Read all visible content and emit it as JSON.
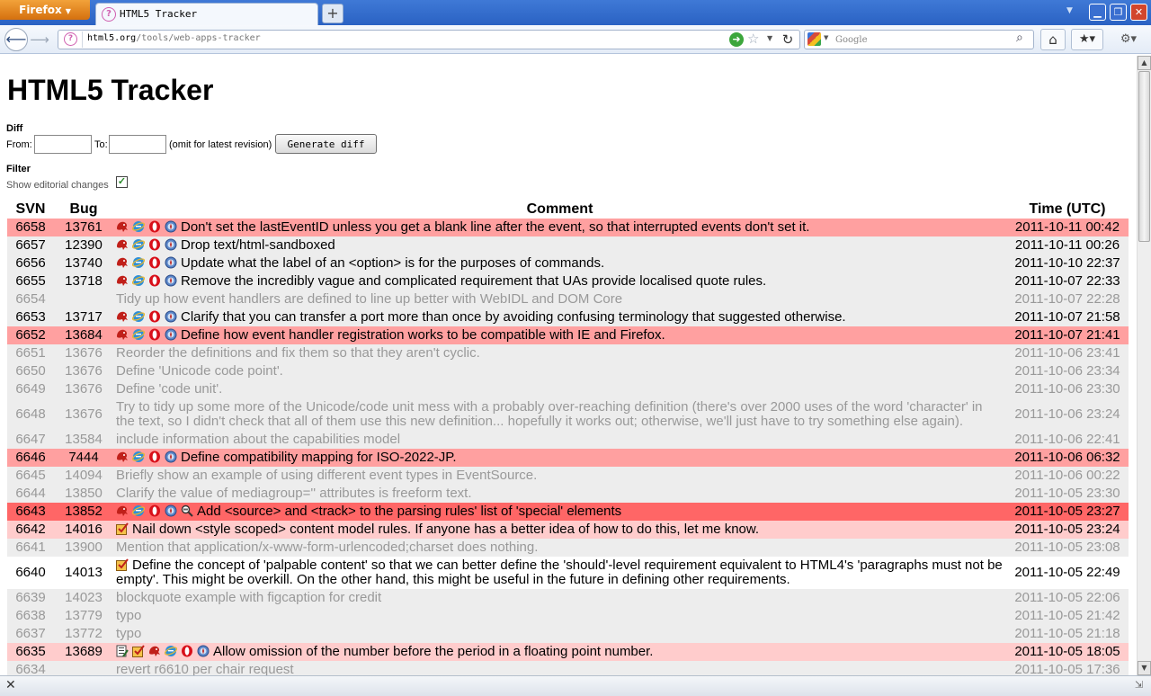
{
  "browser": {
    "app_button": "Firefox",
    "tab_title": "HTML5 Tracker",
    "new_tab": "+",
    "url_host": "html5.org",
    "url_path": "/tools/web-apps-tracker",
    "search_placeholder": "Google"
  },
  "page": {
    "title": "HTML5 Tracker",
    "diff": {
      "heading": "Diff",
      "from_label": "From:",
      "to_label": "To:",
      "omit_note": "(omit for latest revision)",
      "button": "Generate diff"
    },
    "filter": {
      "heading": "Filter",
      "editorial_label": "Show editorial changes",
      "editorial_checked": true
    },
    "table": {
      "headers": {
        "svn": "SVN",
        "bug": "Bug",
        "comment": "Comment",
        "time": "Time (UTC)"
      },
      "rows": [
        {
          "svn": "6658",
          "bug": "13761",
          "comment": "Don't set the lastEventID unless you get a blank line after the event, so that interrupted events don't set it.",
          "time": "2011-10-11 00:42",
          "style": "red",
          "editorial": false,
          "icons": [
            "gecko-icon",
            "ie-icon",
            "opera-icon",
            "webkit-icon"
          ]
        },
        {
          "svn": "6657",
          "bug": "12390",
          "comment": "Drop text/html-sandboxed",
          "time": "2011-10-11 00:26",
          "style": "default",
          "editorial": false,
          "icons": [
            "gecko-icon",
            "ie-icon",
            "opera-icon",
            "webkit-icon"
          ]
        },
        {
          "svn": "6656",
          "bug": "13740",
          "comment": "Update what the label of an <option> is for the purposes of commands.",
          "time": "2011-10-10 22:37",
          "style": "default",
          "editorial": false,
          "icons": [
            "gecko-icon",
            "ie-icon",
            "opera-icon",
            "webkit-icon"
          ]
        },
        {
          "svn": "6655",
          "bug": "13718",
          "comment": "Remove the incredibly vague and complicated requirement that UAs provide localised quote rules.",
          "time": "2011-10-07 22:33",
          "style": "default",
          "editorial": false,
          "icons": [
            "gecko-icon",
            "ie-icon",
            "opera-icon",
            "webkit-icon"
          ]
        },
        {
          "svn": "6654",
          "bug": "",
          "comment": "Tidy up how event handlers are defined to line up better with WebIDL and DOM Core",
          "time": "2011-10-07 22:28",
          "style": "default",
          "editorial": true,
          "icons": []
        },
        {
          "svn": "6653",
          "bug": "13717",
          "comment": "Clarify that you can transfer a port more than once by avoiding confusing terminology that suggested otherwise.",
          "time": "2011-10-07 21:58",
          "style": "default",
          "editorial": false,
          "icons": [
            "gecko-icon",
            "ie-icon",
            "opera-icon",
            "webkit-icon"
          ]
        },
        {
          "svn": "6652",
          "bug": "13684",
          "comment": "Define how event handler registration works to be compatible with IE and Firefox.",
          "time": "2011-10-07 21:41",
          "style": "red",
          "editorial": false,
          "icons": [
            "gecko-icon",
            "ie-icon",
            "opera-icon",
            "webkit-icon"
          ]
        },
        {
          "svn": "6651",
          "bug": "13676",
          "comment": "Reorder the definitions and fix them so that they aren't cyclic.",
          "time": "2011-10-06 23:41",
          "style": "default",
          "editorial": true,
          "icons": []
        },
        {
          "svn": "6650",
          "bug": "13676",
          "comment": "Define 'Unicode code point'.",
          "time": "2011-10-06 23:34",
          "style": "default",
          "editorial": true,
          "icons": []
        },
        {
          "svn": "6649",
          "bug": "13676",
          "comment": "Define 'code unit'.",
          "time": "2011-10-06 23:30",
          "style": "default",
          "editorial": true,
          "icons": []
        },
        {
          "svn": "6648",
          "bug": "13676",
          "comment": "Try to tidy up some more of the Unicode/code unit mess with a probably over-reaching definition (there's over 2000 uses of the word 'character' in the text, so I didn't check that all of them use this new definition... hopefully it works out; otherwise, we'll just have to try something else again).",
          "time": "2011-10-06 23:24",
          "style": "default",
          "editorial": true,
          "icons": [],
          "tall": true
        },
        {
          "svn": "6647",
          "bug": "13584",
          "comment": "include information about the capabilities model",
          "time": "2011-10-06 22:41",
          "style": "default",
          "editorial": true,
          "icons": []
        },
        {
          "svn": "6646",
          "bug": "7444",
          "comment": "Define compatibility mapping for ISO-2022-JP.",
          "time": "2011-10-06 06:32",
          "style": "red",
          "editorial": false,
          "icons": [
            "gecko-icon",
            "ie-icon",
            "opera-icon",
            "webkit-icon"
          ]
        },
        {
          "svn": "6645",
          "bug": "14094",
          "comment": "Briefly show an example of using different event types in EventSource.",
          "time": "2011-10-06 00:22",
          "style": "default",
          "editorial": true,
          "icons": []
        },
        {
          "svn": "6644",
          "bug": "13850",
          "comment": "Clarify the value of mediagroup='' attributes is freeform text.",
          "time": "2011-10-05 23:30",
          "style": "default",
          "editorial": true,
          "icons": []
        },
        {
          "svn": "6643",
          "bug": "13852",
          "comment": "Add <source> and <track> to the parsing rules' list of 'special' elements",
          "time": "2011-10-05 23:27",
          "style": "bright",
          "editorial": false,
          "icons": [
            "gecko-icon",
            "ie-icon",
            "opera-icon",
            "webkit-icon",
            "validator-icon"
          ]
        },
        {
          "svn": "6642",
          "bug": "14016",
          "comment": "Nail down <style scoped> content model rules. If anyone has a better idea of how to do this, let me know.",
          "time": "2011-10-05 23:24",
          "style": "pink",
          "editorial": false,
          "icons": [
            "conformance-icon"
          ]
        },
        {
          "svn": "6641",
          "bug": "13900",
          "comment": "Mention that application/x-www-form-urlencoded;charset does nothing.",
          "time": "2011-10-05 23:08",
          "style": "default",
          "editorial": true,
          "icons": []
        },
        {
          "svn": "6640",
          "bug": "14013",
          "comment": "Define the concept of 'palpable content' so that we can better define the 'should'-level requirement equivalent to HTML4's 'paragraphs must not be empty'. This might be overkill. On the other hand, this might be useful in the future in defining other requirements.",
          "time": "2011-10-05 22:49",
          "style": "white",
          "editorial": false,
          "icons": [
            "conformance-icon"
          ],
          "tall": true
        },
        {
          "svn": "6639",
          "bug": "14023",
          "comment": "blockquote example with figcaption for credit",
          "time": "2011-10-05 22:06",
          "style": "default",
          "editorial": true,
          "icons": []
        },
        {
          "svn": "6638",
          "bug": "13779",
          "comment": "typo",
          "time": "2011-10-05 21:42",
          "style": "default",
          "editorial": true,
          "icons": []
        },
        {
          "svn": "6637",
          "bug": "13772",
          "comment": "typo",
          "time": "2011-10-05 21:18",
          "style": "default",
          "editorial": true,
          "icons": []
        },
        {
          "svn": "6635",
          "bug": "13689",
          "comment": "Allow omission of the number before the period in a floating point number.",
          "time": "2011-10-05 18:05",
          "style": "pink",
          "editorial": false,
          "icons": [
            "authoring-tool-icon",
            "conformance-icon",
            "gecko-icon",
            "ie-icon",
            "opera-icon",
            "webkit-icon"
          ]
        },
        {
          "svn": "6634",
          "bug": "",
          "comment": "revert r6610 per chair request",
          "time": "2011-10-05 17:36",
          "style": "default",
          "editorial": true,
          "icons": []
        }
      ]
    }
  },
  "colors": {
    "row_default": "#ededed",
    "row_red": "#ffa0a0",
    "row_bright": "#ff6666",
    "row_pink": "#ffcccc",
    "editorial_text": "#999999"
  }
}
